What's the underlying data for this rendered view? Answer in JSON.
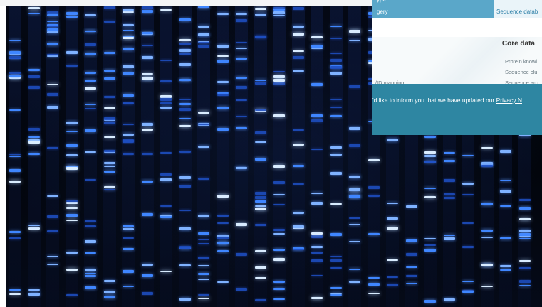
{
  "table_rows": [
    {
      "label": "ype",
      "value": ""
    },
    {
      "label": "gery",
      "value": "Sequence datab"
    }
  ],
  "core": {
    "title": "Core data",
    "items": [
      "Protein knowl",
      "Sequence clu",
      "Sequence arc"
    ],
    "left_item": "/ID mapping"
  },
  "banner": {
    "text": "'d like to inform you that we have updated our ",
    "link": "Privacy N"
  },
  "colors": {
    "gel_background": "#03060f",
    "band": "#3f86ff",
    "band_bright": "#d9ecff",
    "table_header": "#5aa7c9",
    "banner": "#2e86a2"
  }
}
